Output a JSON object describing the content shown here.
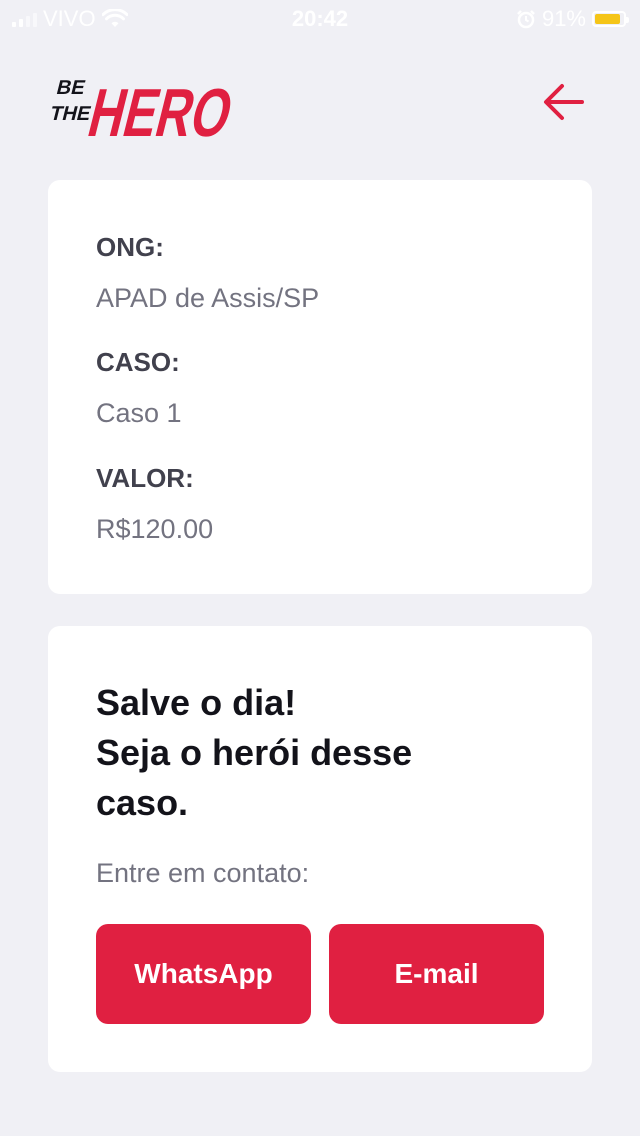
{
  "status_bar": {
    "carrier": "VIVO",
    "time": "20:42",
    "battery": "91%",
    "battery_level": 0.91,
    "battery_color": "#f5c518"
  },
  "header": {
    "logo_line1": "BE",
    "logo_line2": "THE",
    "logo_word": "HERO",
    "back_icon": "arrow-left-icon"
  },
  "incident": {
    "ong_label": "ONG:",
    "ong_value": "APAD de Assis/SP",
    "case_label": "CASO:",
    "case_value": "Caso 1",
    "value_label": "VALOR:",
    "value_value": "R$120.00"
  },
  "contact": {
    "title_line1": "Salve o dia!",
    "title_line2": "Seja o herói desse",
    "title_line3": "caso.",
    "description": "Entre em contato:",
    "whatsapp_label": "WhatsApp",
    "email_label": "E-mail"
  },
  "colors": {
    "accent": "#e02041",
    "background": "#f0f0f5",
    "card": "#ffffff",
    "label": "#41414d",
    "value": "#737380"
  }
}
